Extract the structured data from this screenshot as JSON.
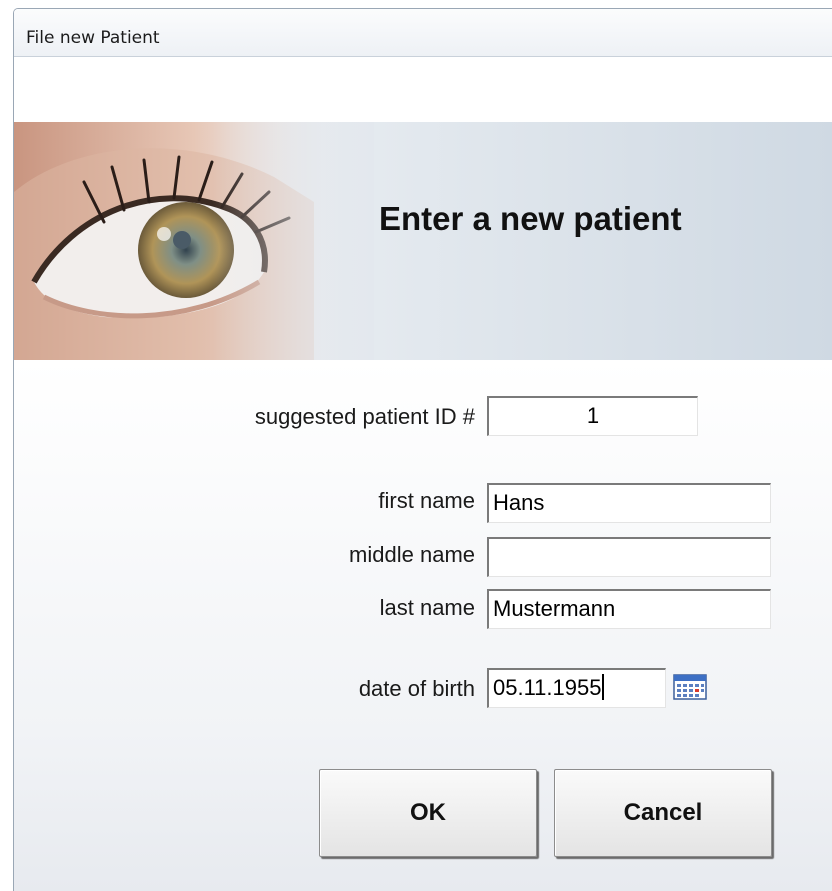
{
  "window": {
    "title": "File new Patient"
  },
  "banner": {
    "title": "Enter a new patient"
  },
  "form": {
    "patient_id": {
      "label": "suggested patient ID #",
      "value": "1"
    },
    "first_name": {
      "label": "first name",
      "value": "Hans"
    },
    "middle_name": {
      "label": "middle name",
      "value": ""
    },
    "last_name": {
      "label": "last name",
      "value": "Mustermann"
    },
    "date_of_birth": {
      "label": "date of birth",
      "value": "05.11.1955",
      "icon": "calendar-icon"
    }
  },
  "buttons": {
    "ok_label": "OK",
    "cancel_label": "Cancel"
  }
}
